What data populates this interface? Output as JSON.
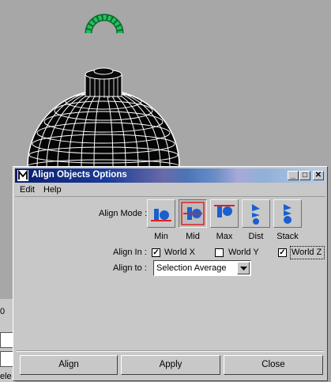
{
  "background": {
    "side_value": "0",
    "side_text": "ele"
  },
  "window": {
    "title": "Align Objects Options",
    "controls": {
      "minimize": "_",
      "maximize": "□",
      "close": "✕"
    }
  },
  "menu": {
    "items": [
      "Edit",
      "Help"
    ]
  },
  "align_mode": {
    "label": "Align Mode :",
    "options": [
      {
        "label": "Min",
        "icon": "align-min-icon",
        "selected": false
      },
      {
        "label": "Mid",
        "icon": "align-mid-icon",
        "selected": true
      },
      {
        "label": "Max",
        "icon": "align-max-icon",
        "selected": false
      },
      {
        "label": "Dist",
        "icon": "align-dist-icon",
        "selected": false
      },
      {
        "label": "Stack",
        "icon": "align-stack-icon",
        "selected": false
      }
    ]
  },
  "align_in": {
    "label": "Align In :",
    "options": [
      {
        "label": "World X",
        "checked": true
      },
      {
        "label": "World Y",
        "checked": false
      },
      {
        "label": "World Z",
        "checked": true
      }
    ]
  },
  "align_to": {
    "label": "Align to :",
    "value": "Selection Average"
  },
  "buttons": {
    "align": "Align",
    "apply": "Apply",
    "close": "Close"
  },
  "colors": {
    "title_start": "#0a1e6e",
    "icon_blue": "#1a5fd0",
    "icon_red": "#e02020",
    "manipulator_green": "#22c060"
  }
}
